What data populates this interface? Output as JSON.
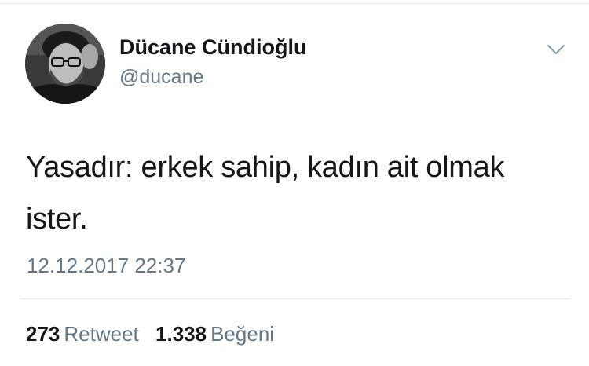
{
  "tweet": {
    "author": {
      "display_name": "Dücane Cündioğlu",
      "handle": "@ducane"
    },
    "text": "Yasadır: erkek sahip, kadın ait olmak ister.",
    "timestamp": "12.12.2017 22:37",
    "stats": {
      "retweet_count": "273",
      "retweet_label": "Retweet",
      "like_count": "1.338",
      "like_label": "Beğeni"
    },
    "icons": {
      "menu": "chevron-down-icon"
    }
  },
  "colors": {
    "text_primary": "#14171a",
    "text_secondary": "#657786",
    "divider": "#e1e8ed"
  }
}
